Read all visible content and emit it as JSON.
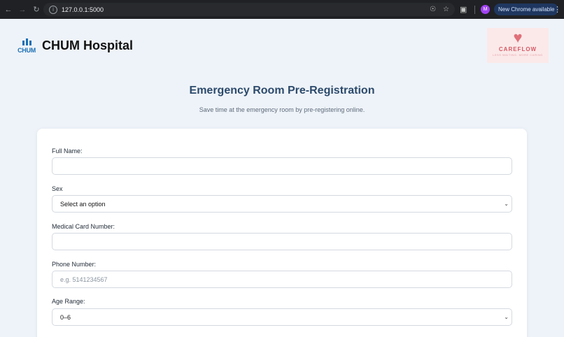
{
  "browser": {
    "url": "127.0.0.1:5000",
    "update_label": "New Chrome available",
    "profile_initial": "M"
  },
  "header": {
    "logo_text": "CHUM",
    "title": "CHUM Hospital",
    "partner_logo_name": "CAREFLOW",
    "partner_logo_tagline": "LESS WAITING. MORE CARING"
  },
  "page": {
    "heading": "Emergency Room Pre-Registration",
    "subtitle": "Save time at the emergency room by pre-registering online."
  },
  "form": {
    "full_name_label": "Full Name:",
    "full_name_value": "",
    "sex_label": "Sex",
    "sex_value": "Select an option",
    "medical_card_label": "Medical Card Number:",
    "medical_card_value": "",
    "phone_label": "Phone Number:",
    "phone_placeholder": "e.g. 5141234567",
    "age_range_label": "Age Range:",
    "age_range_value": "0–6"
  }
}
